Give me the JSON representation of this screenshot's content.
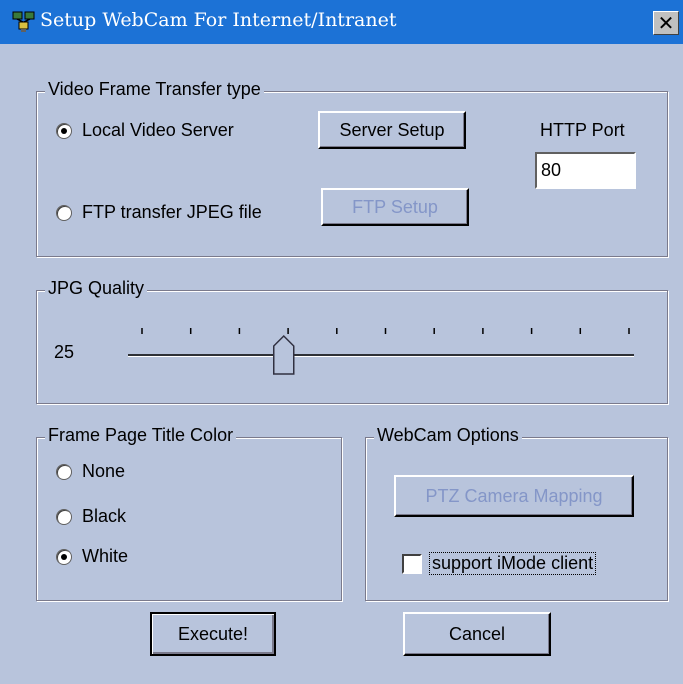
{
  "window": {
    "title": "Setup WebCam For Internet/Intranet",
    "close_glyph": "✕"
  },
  "video_frame": {
    "group_label": "Video Frame Transfer type",
    "local_server_label": "Local Video Server",
    "local_server_selected": true,
    "ftp_label": "FTP transfer JPEG file",
    "ftp_selected": false,
    "server_setup_label": "Server Setup",
    "ftp_setup_label": "FTP Setup",
    "http_port_label": "HTTP Port",
    "http_port_value": "80"
  },
  "jpg_quality": {
    "group_label": "JPG Quality",
    "value_text": "25",
    "value": 25,
    "min": 0,
    "max": 100,
    "tick_count": 11
  },
  "title_color": {
    "group_label": "Frame Page Title Color",
    "options": [
      {
        "label": "None",
        "selected": false
      },
      {
        "label": "Black",
        "selected": false
      },
      {
        "label": "White",
        "selected": true
      }
    ]
  },
  "webcam_options": {
    "group_label": "WebCam Options",
    "ptz_label": "PTZ Camera Mapping",
    "imode_label": "support iMode client",
    "imode_checked": false
  },
  "actions": {
    "execute_label": "Execute!",
    "cancel_label": "Cancel"
  },
  "icons": {
    "title_icon": "webcam-network-icon",
    "close_icon": "close-icon"
  },
  "colors": {
    "titlebar": "#1c72d6",
    "dialog_bg": "#b8c4dc",
    "disabled_text": "#8496c8"
  }
}
